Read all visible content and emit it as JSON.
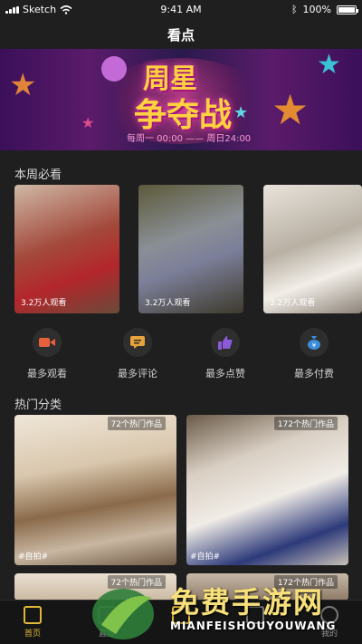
{
  "status": {
    "carrier": "Sketch",
    "time": "9:41 AM",
    "battery": "100%"
  },
  "header": {
    "title": "看点"
  },
  "banner": {
    "line1": "周星",
    "line2": "争夺战",
    "schedule": "每周一 00:00 —— 周日24:00"
  },
  "weekly": {
    "title": "本周必看",
    "items": [
      {
        "views": "3.2万人观看"
      },
      {
        "views": "3.2万人观看"
      },
      {
        "views": "3.2万人观看"
      }
    ]
  },
  "categories": [
    {
      "label": "最多观看",
      "icon": "video-camera-icon",
      "color": "#e8613c"
    },
    {
      "label": "最多评论",
      "icon": "comment-icon",
      "color": "#e8a33a"
    },
    {
      "label": "最多点赞",
      "icon": "thumbs-up-icon",
      "color": "#8a5ad8"
    },
    {
      "label": "最多付费",
      "icon": "money-bag-icon",
      "color": "#3a8ed8"
    }
  ],
  "hot": {
    "title": "热门分类",
    "items": [
      {
        "count": "72个热门作品",
        "tag": "#自拍#"
      },
      {
        "count": "172个热门作品",
        "tag": "#自拍#"
      },
      {
        "count": "72个热门作品",
        "tag": ""
      },
      {
        "count": "172个热门作品",
        "tag": ""
      }
    ]
  },
  "tabs": [
    {
      "label": "首页",
      "active": true
    },
    {
      "label": "直播",
      "active": false
    },
    {
      "label": "",
      "active": false
    },
    {
      "label": "",
      "active": false
    },
    {
      "label": "我的",
      "active": false
    }
  ],
  "watermark": {
    "text1": "免费手游网",
    "text2": "MIANFEISHOUYOUWANG"
  }
}
